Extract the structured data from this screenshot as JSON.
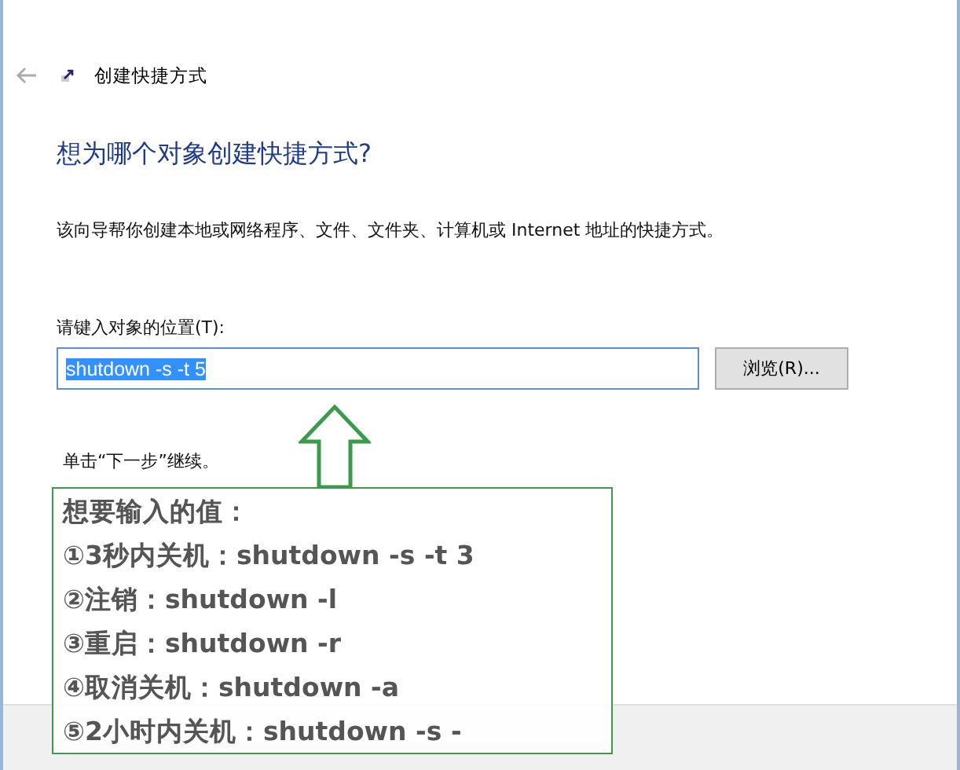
{
  "window": {
    "title": "创建快捷方式"
  },
  "heading": "想为哪个对象创建快捷方式?",
  "description": "该向导帮你创建本地或网络程序、文件、文件夹、计算机或 Internet 地址的快捷方式。",
  "location": {
    "label": "请键入对象的位置(T):",
    "value": "shutdown -s -t 5",
    "selected": true
  },
  "browse_button": "浏览(R)...",
  "hint": "单击“下一步”继续。",
  "annotation": {
    "lines": [
      "想要输入的值：",
      "①3秒内关机：shutdown -s -t 3",
      "②注销：shutdown -l",
      "③重启：shutdown -r",
      "④取消关机：shutdown -a",
      "⑤2小时内关机：shutdown -s -"
    ]
  }
}
